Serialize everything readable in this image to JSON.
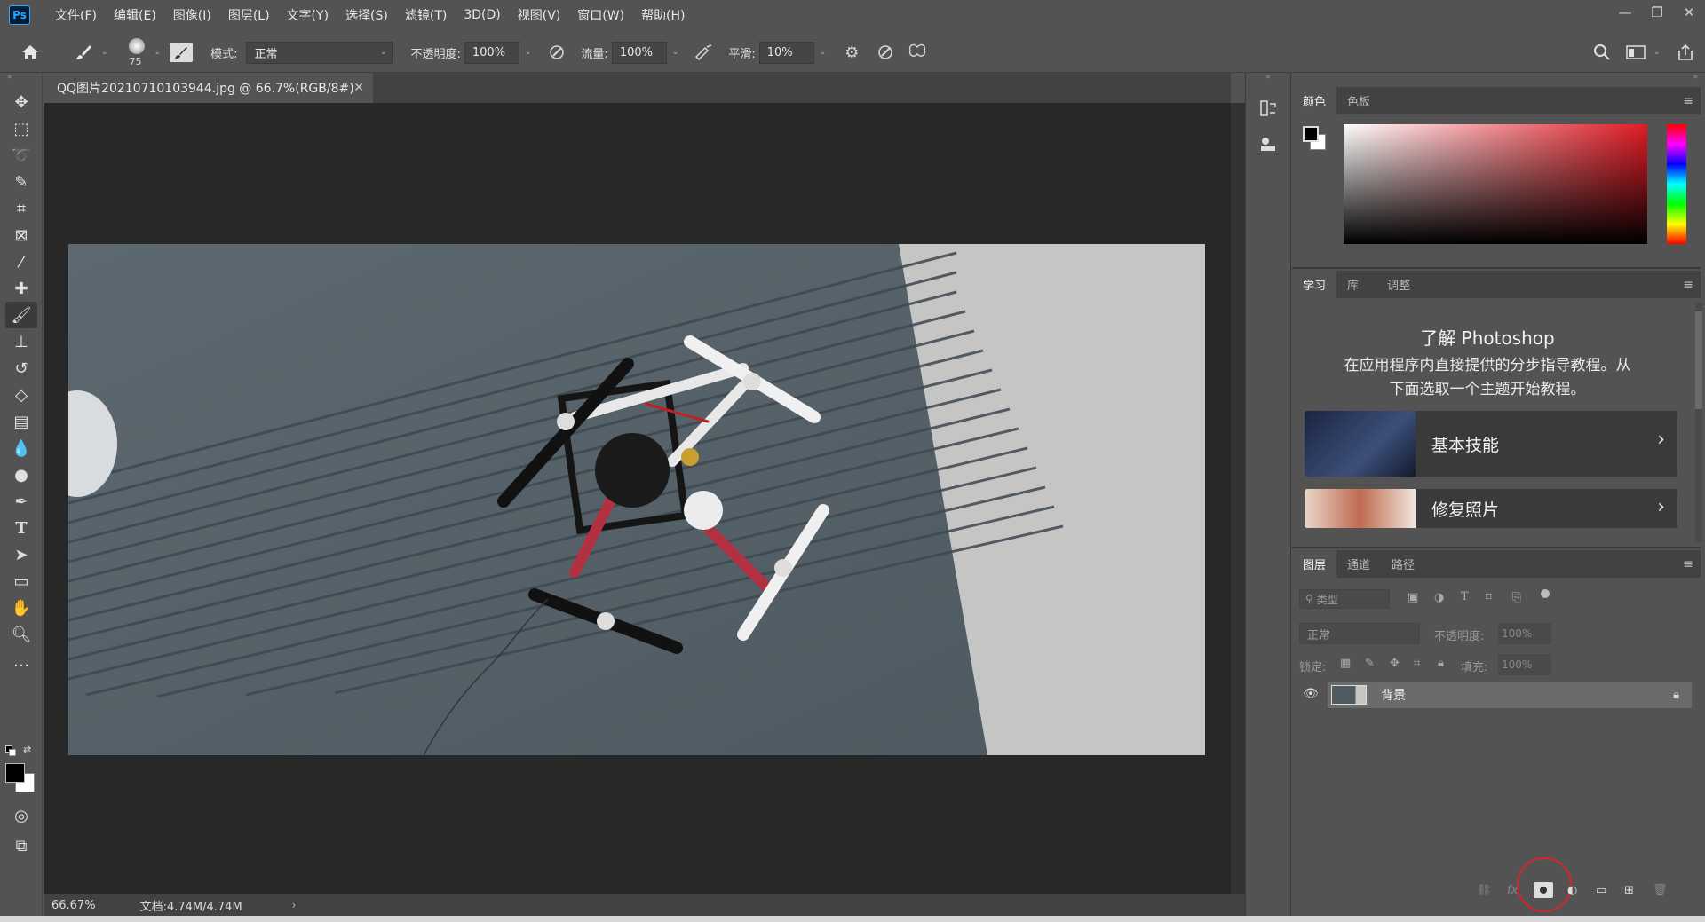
{
  "app": {
    "name": "Ps"
  },
  "menu": [
    "文件(F)",
    "编辑(E)",
    "图像(I)",
    "图层(L)",
    "文字(Y)",
    "选择(S)",
    "滤镜(T)",
    "3D(D)",
    "视图(V)",
    "窗口(W)",
    "帮助(H)"
  ],
  "options": {
    "brush_size": "75",
    "mode_label": "模式:",
    "mode_value": "正常",
    "opacity_label": "不透明度:",
    "opacity_value": "100%",
    "flow_label": "流量:",
    "flow_value": "100%",
    "smooth_label": "平滑:",
    "smooth_value": "10%"
  },
  "document": {
    "tab_title": "QQ图片20210710103944.jpg @ 66.7%(RGB/8#)",
    "zoom": "66.67%",
    "doc_info": "文档:4.74M/4.74M"
  },
  "color_panel": {
    "tabs": [
      "颜色",
      "色板"
    ]
  },
  "learn_panel": {
    "tabs": [
      "学习",
      "库",
      "调整"
    ],
    "title": "了解 Photoshop",
    "description_line1": "在应用程序内直接提供的分步指导教程。从",
    "description_line2": "下面选取一个主题开始教程。",
    "cards": [
      "基本技能",
      "修复照片"
    ]
  },
  "layers_panel": {
    "tabs": [
      "图层",
      "通道",
      "路径"
    ],
    "filter_placeholder": "类型",
    "blend_mode": "正常",
    "opacity_label": "不透明度:",
    "opacity_value": "100%",
    "lock_label": "锁定:",
    "fill_label": "填充:",
    "fill_value": "100%",
    "layers": [
      {
        "name": "背景",
        "visible": true,
        "locked": true
      }
    ]
  },
  "colors": {
    "accent_red": "#d9232e",
    "ps_blue": "#31a8ff"
  }
}
